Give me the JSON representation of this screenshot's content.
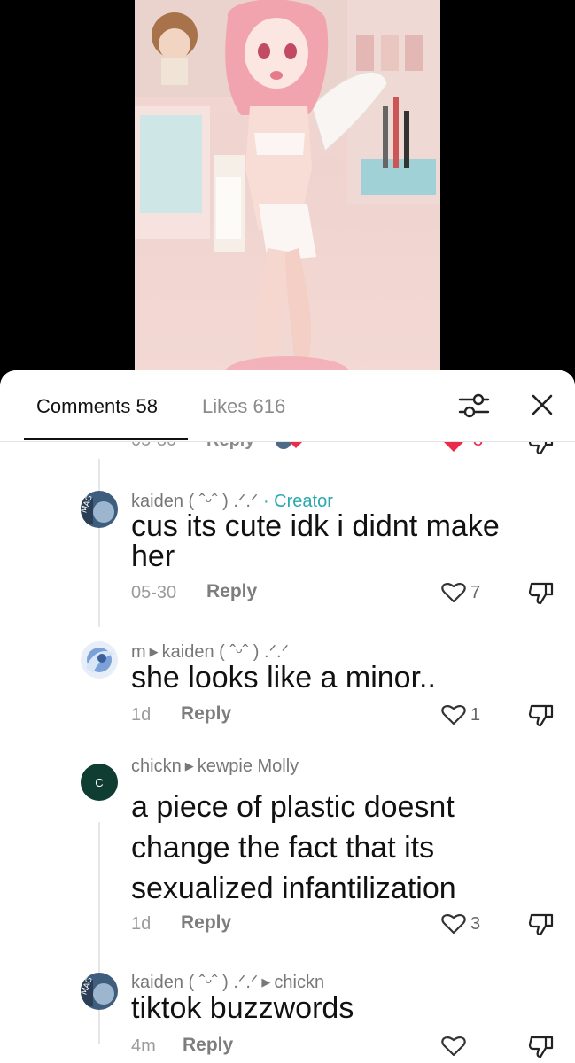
{
  "tabs": {
    "comments_label": "Comments 58",
    "likes_label": "Likes 616"
  },
  "icons": {
    "filter": "filter-sliders-icon",
    "close": "close-icon",
    "like": "heart-outline-icon",
    "dislike": "thumbs-down-icon"
  },
  "colors": {
    "creator": "#2aa8b0",
    "liked_heart": "#ea2b4b",
    "avatar_c": "#0f3d31"
  },
  "previous": {
    "date": "05-30",
    "reply_label": "Reply",
    "likes": "3"
  },
  "comments": [
    {
      "author": "kaiden ( ˆᵕˆ ) .ᐟ.ᐟ",
      "creator_tag": "· Creator",
      "text": "cus its cute idk i didnt make her",
      "date": "05-30",
      "reply_label": "Reply",
      "likes": "7"
    },
    {
      "author": "m",
      "reply_to": "kaiden ( ˆᵕˆ ) .ᐟ.ᐟ",
      "text": "she looks like a minor..",
      "date": "1d",
      "reply_label": "Reply",
      "likes": "1"
    },
    {
      "author": "chickn",
      "avatar_letter": "C",
      "reply_to": "kewpie Molly",
      "text": "a piece of plastic doesnt change the fact that its sexualized infantilization",
      "date": "1d",
      "reply_label": "Reply",
      "likes": "3"
    },
    {
      "author": "kaiden ( ˆᵕˆ ) .ᐟ.ᐟ",
      "reply_to": "chickn",
      "text": "tiktok buzzwords",
      "date": "4m",
      "reply_label": "Reply"
    }
  ]
}
